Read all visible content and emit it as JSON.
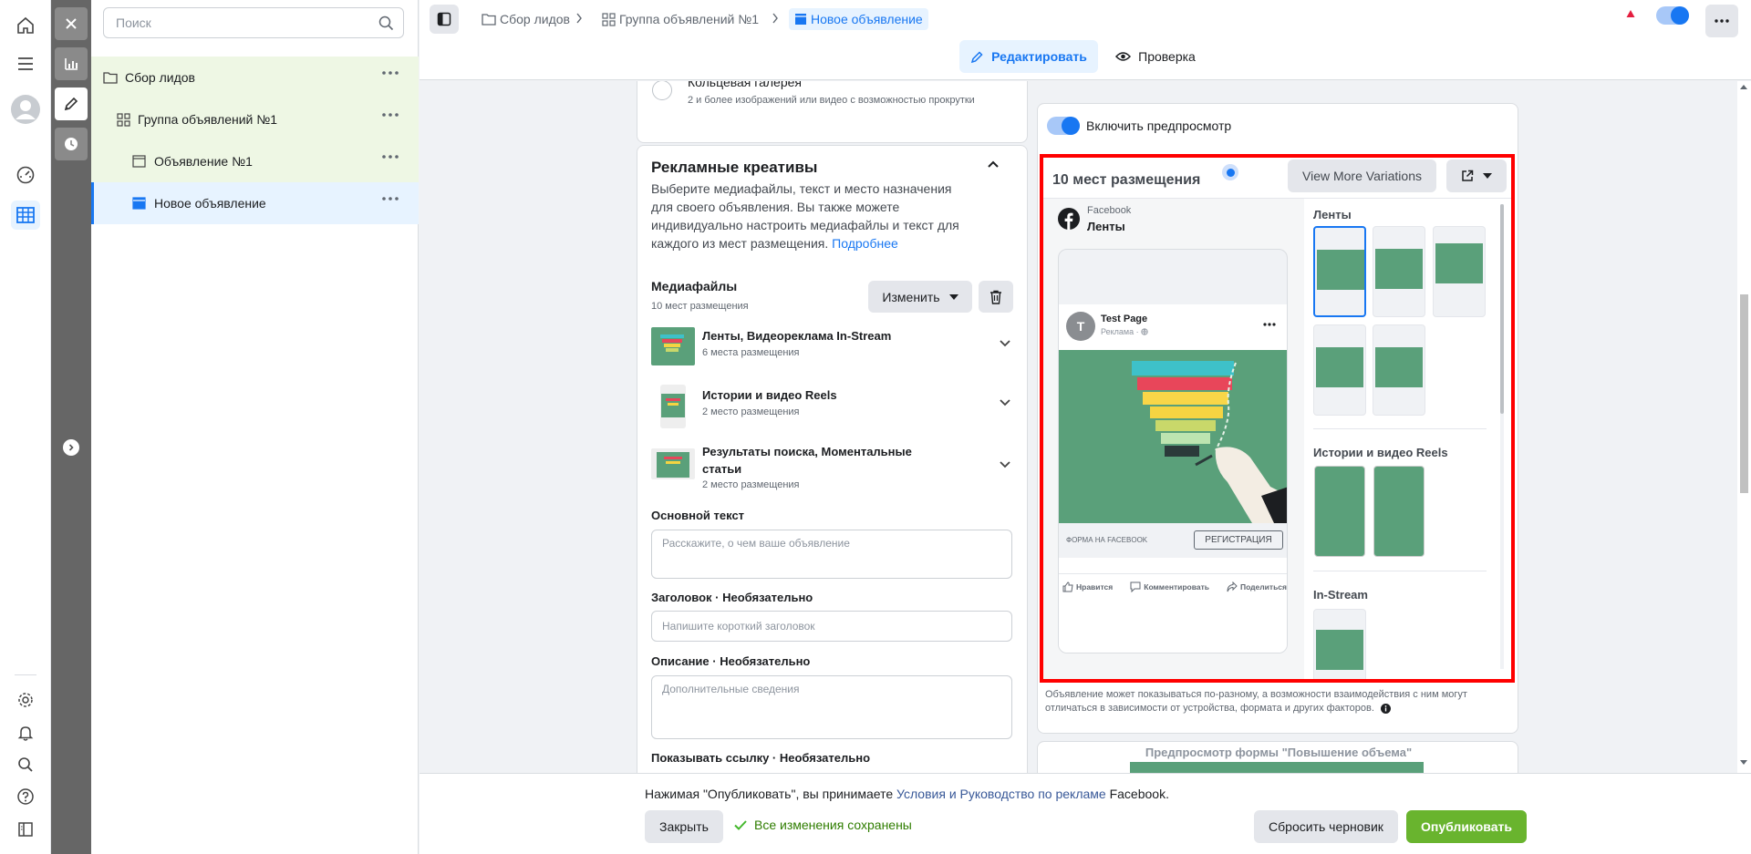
{
  "search": {
    "placeholder": "Поиск"
  },
  "tree": {
    "items": [
      {
        "label": "Сбор лидов"
      },
      {
        "label": "Группа объявлений №1"
      },
      {
        "label": "Объявление №1"
      },
      {
        "label": "Новое объявление"
      }
    ]
  },
  "breadcrumb": {
    "campaign": "Сбор лидов",
    "adset": "Группа объявлений №1",
    "ad": "Новое объявление"
  },
  "mode_tabs": {
    "edit": "Редактировать",
    "review": "Проверка"
  },
  "format": {
    "carousel_label": "Кольцевая галерея",
    "carousel_desc": "2 и более изображений или видео с возможностью прокрутки"
  },
  "creatives": {
    "title": "Рекламные креативы",
    "description": "Выберите медиафайлы, текст и место назначения для своего объявления. Вы также можете индивидуально настроить медиафайлы и текст для каждого из мест размещения.",
    "learn_more": "Подробнее",
    "media_title": "Медиафайлы",
    "media_count": "10 мест размещения",
    "change_button": "Изменить",
    "groups": [
      {
        "title": "Ленты, Видеореклама In-Stream",
        "count": "6 места размещения"
      },
      {
        "title": "Истории и видео Reels",
        "count": "2 место размещения"
      },
      {
        "title": "Результаты поиска, Моментальные статьи",
        "count": "2 место размещения"
      }
    ],
    "primary_text_label": "Основной текст",
    "primary_text_placeholder": "Расскажите, о чем ваше объявление",
    "headline_label": "Заголовок · Необязательно",
    "headline_placeholder": "Напишите короткий заголовок",
    "description_label": "Описание · Необязательно",
    "description_placeholder": "Дополнительные сведения",
    "display_link_label": "Показывать ссылку · Необязательно"
  },
  "preview": {
    "toggle_label": "Включить предпросмотр",
    "placements_title": "10 мест размещения",
    "view_more": "View More Variations",
    "platform": "Facebook",
    "placement": "Ленты",
    "page_name": "Test Page",
    "sponsored": "Реклама · ",
    "form_label": "ФОРМА НА FACEBOOK",
    "cta": "РЕГИСТРАЦИЯ",
    "like": "Нравится",
    "comment": "Комментировать",
    "share": "Поделиться",
    "section_feeds": "Ленты",
    "section_stories": "Истории и видео Reels",
    "section_instream": "In-Stream",
    "note": "Объявление может показываться по-разному, а возможности взаимодействия с ним могут отличаться в зависимости от устройства, формата и других факторов.",
    "form_preview_title": "Предпросмотр формы \"Повышение объема\""
  },
  "footer": {
    "terms_prefix": "Нажимая \"Опубликовать\", вы принимаете",
    "terms_link": "Условия и Руководство по рекламе",
    "terms_suffix": "Facebook.",
    "close": "Закрыть",
    "saved": "Все изменения сохранены",
    "reset": "Сбросить черновик",
    "publish": "Опубликовать"
  },
  "colors": {
    "accent": "#1877f2",
    "publish": "#69b42e",
    "highlight": "#ff0000",
    "tree_green": "#eef7e4"
  }
}
